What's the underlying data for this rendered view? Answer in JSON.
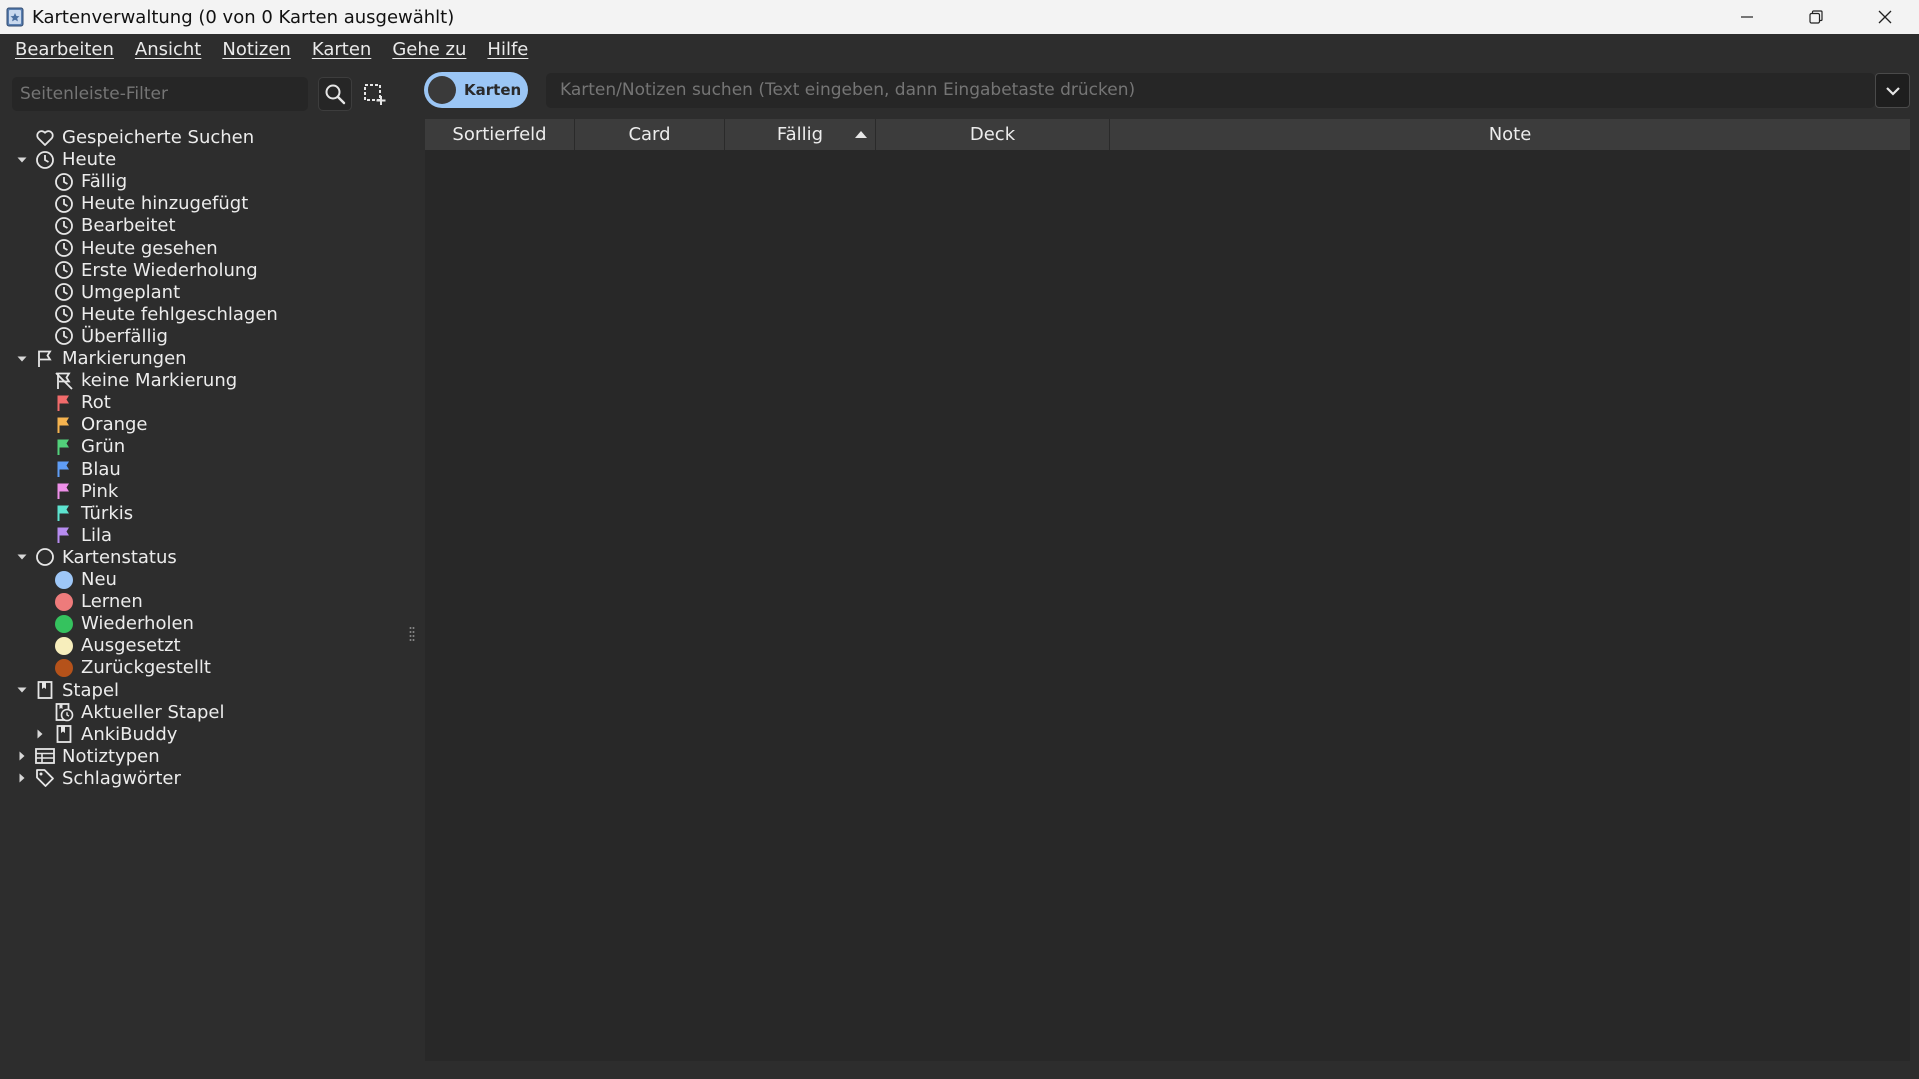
{
  "window": {
    "title": "Kartenverwaltung (0 von 0 Karten ausgewählt)"
  },
  "menu": [
    {
      "label": "Bearbeiten"
    },
    {
      "label": "Ansicht"
    },
    {
      "label": "Notizen"
    },
    {
      "label": "Karten"
    },
    {
      "label": "Gehe zu"
    },
    {
      "label": "Hilfe"
    }
  ],
  "sidebar": {
    "filter_placeholder": "Seitenleiste-Filter",
    "items": [
      {
        "label": "Gespeicherte Suchen",
        "icon": "heart-icon",
        "expander": "none"
      },
      {
        "label": "Heute",
        "icon": "clock-icon",
        "expander": "expanded"
      },
      {
        "label": "Fällig",
        "icon": "clock-icon",
        "expander": "none"
      },
      {
        "label": "Heute hinzugefügt",
        "icon": "clock-icon",
        "expander": "none"
      },
      {
        "label": "Bearbeitet",
        "icon": "clock-icon",
        "expander": "none"
      },
      {
        "label": "Heute gesehen",
        "icon": "clock-icon",
        "expander": "none"
      },
      {
        "label": "Erste Wiederholung",
        "icon": "clock-icon",
        "expander": "none"
      },
      {
        "label": "Umgeplant",
        "icon": "clock-icon",
        "expander": "none"
      },
      {
        "label": "Heute fehlgeschlagen",
        "icon": "clock-icon",
        "expander": "none"
      },
      {
        "label": "Überfällig",
        "icon": "clock-icon",
        "expander": "none"
      },
      {
        "label": "Markierungen",
        "icon": "flag-outline-icon",
        "expander": "expanded"
      },
      {
        "label": "keine Markierung",
        "icon": "flag-off-icon",
        "expander": "none"
      },
      {
        "label": "Rot",
        "icon": "flag-icon",
        "color": "#f16b6b",
        "expander": "none"
      },
      {
        "label": "Orange",
        "icon": "flag-icon",
        "color": "#f5b34f",
        "expander": "none"
      },
      {
        "label": "Grün",
        "icon": "flag-icon",
        "color": "#52d17b",
        "expander": "none"
      },
      {
        "label": "Blau",
        "icon": "flag-icon",
        "color": "#5f9df5",
        "expander": "none"
      },
      {
        "label": "Pink",
        "icon": "flag-icon",
        "color": "#ee90e9",
        "expander": "none"
      },
      {
        "label": "Türkis",
        "icon": "flag-icon",
        "color": "#5de3cf",
        "expander": "none"
      },
      {
        "label": "Lila",
        "icon": "flag-icon",
        "color": "#b78cf0",
        "expander": "none"
      },
      {
        "label": "Kartenstatus",
        "icon": "circle-outline-icon",
        "expander": "expanded"
      },
      {
        "label": "Neu",
        "icon": "dot-icon",
        "color": "#9ec7f7",
        "expander": "none"
      },
      {
        "label": "Lernen",
        "icon": "dot-icon",
        "color": "#ee7b7b",
        "expander": "none"
      },
      {
        "label": "Wiederholen",
        "icon": "dot-icon",
        "color": "#35c25e",
        "expander": "none"
      },
      {
        "label": "Ausgesetzt",
        "icon": "dot-icon",
        "color": "#f7eebc",
        "expander": "none"
      },
      {
        "label": "Zurückgestellt",
        "icon": "dot-icon",
        "color": "#b5521a",
        "expander": "none"
      },
      {
        "label": "Stapel",
        "icon": "deck-icon",
        "expander": "expanded"
      },
      {
        "label": "Aktueller Stapel",
        "icon": "current-deck-icon",
        "expander": "none"
      },
      {
        "label": "AnkiBuddy",
        "icon": "deck-icon",
        "expander": "collapsed"
      },
      {
        "label": "Notiztypen",
        "icon": "notetype-icon",
        "expander": "collapsed"
      },
      {
        "label": "Schlagwörter",
        "icon": "tag-icon",
        "expander": "collapsed"
      }
    ]
  },
  "toolbar": {
    "mode_toggle_label": "Karten",
    "search_placeholder": "Karten/Notizen suchen (Text eingeben, dann Eingabetaste drücken)"
  },
  "table": {
    "columns": [
      {
        "label": "Sortierfeld"
      },
      {
        "label": "Card"
      },
      {
        "label": "Fällig",
        "sorted": "ascending"
      },
      {
        "label": "Deck"
      },
      {
        "label": "Note"
      }
    ],
    "rows": []
  }
}
